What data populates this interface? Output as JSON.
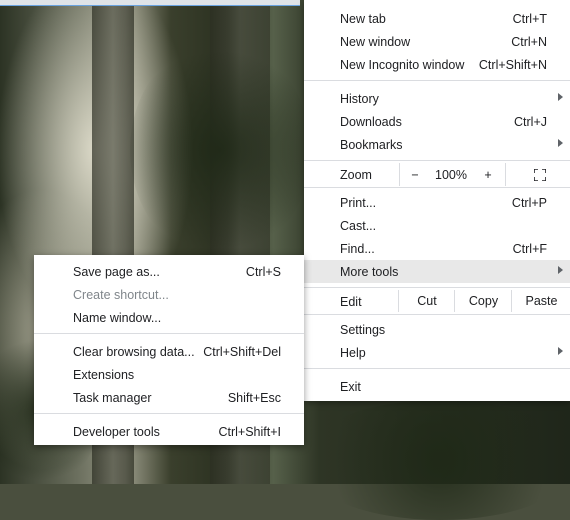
{
  "main_menu": {
    "new_tab": {
      "label": "New tab",
      "shortcut": "Ctrl+T"
    },
    "new_window": {
      "label": "New window",
      "shortcut": "Ctrl+N"
    },
    "new_incognito": {
      "label": "New Incognito window",
      "shortcut": "Ctrl+Shift+N"
    },
    "history": {
      "label": "History"
    },
    "downloads": {
      "label": "Downloads",
      "shortcut": "Ctrl+J"
    },
    "bookmarks": {
      "label": "Bookmarks"
    },
    "zoom": {
      "label": "Zoom",
      "minus": "−",
      "value": "100%",
      "plus": "+",
      "fullscreen_icon": "fullscreen-icon"
    },
    "print": {
      "label": "Print...",
      "shortcut": "Ctrl+P"
    },
    "cast": {
      "label": "Cast..."
    },
    "find": {
      "label": "Find...",
      "shortcut": "Ctrl+F"
    },
    "more_tools": {
      "label": "More tools"
    },
    "edit": {
      "label": "Edit",
      "cut": "Cut",
      "copy": "Copy",
      "paste": "Paste"
    },
    "settings": {
      "label": "Settings"
    },
    "help": {
      "label": "Help"
    },
    "exit": {
      "label": "Exit"
    }
  },
  "sub_menu": {
    "save_page": {
      "label": "Save page as...",
      "shortcut": "Ctrl+S"
    },
    "create_shortcut": {
      "label": "Create shortcut..."
    },
    "name_window": {
      "label": "Name window..."
    },
    "clear_browsing": {
      "label": "Clear browsing data...",
      "shortcut": "Ctrl+Shift+Del"
    },
    "extensions": {
      "label": "Extensions"
    },
    "task_manager": {
      "label": "Task manager",
      "shortcut": "Shift+Esc"
    },
    "developer_tools": {
      "label": "Developer tools",
      "shortcut": "Ctrl+Shift+I"
    }
  }
}
